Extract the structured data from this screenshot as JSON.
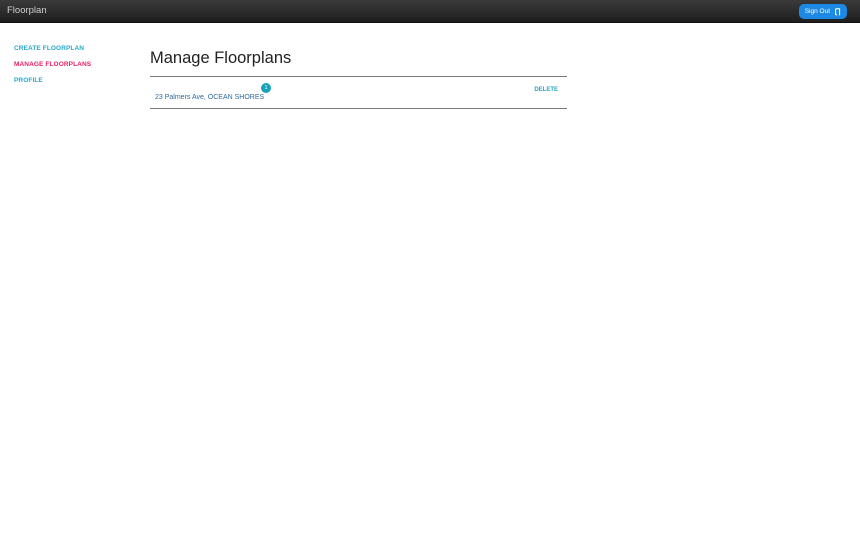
{
  "app": {
    "title": "Floorplan"
  },
  "header": {
    "sign_out_label": "Sign Out",
    "sign_out_icon": "sign-out-icon"
  },
  "sidebar": {
    "items": [
      {
        "label": "CREATE FLOORPLAN",
        "active": false
      },
      {
        "label": "MANAGE FLOORPLANS",
        "active": true
      },
      {
        "label": "PROFILE",
        "active": false
      }
    ]
  },
  "main": {
    "title": "Manage Floorplans",
    "floorplans": [
      {
        "address": "23 Palmers Ave, OCEAN SHORES",
        "count": "1",
        "action_label": "DELETE"
      }
    ]
  },
  "colors": {
    "topbar": "#2b2b2b",
    "accent_blue": "#1e88e5",
    "link_teal": "#26a7c9",
    "active_pink": "#e91e63",
    "badge": "#17a2b8"
  }
}
